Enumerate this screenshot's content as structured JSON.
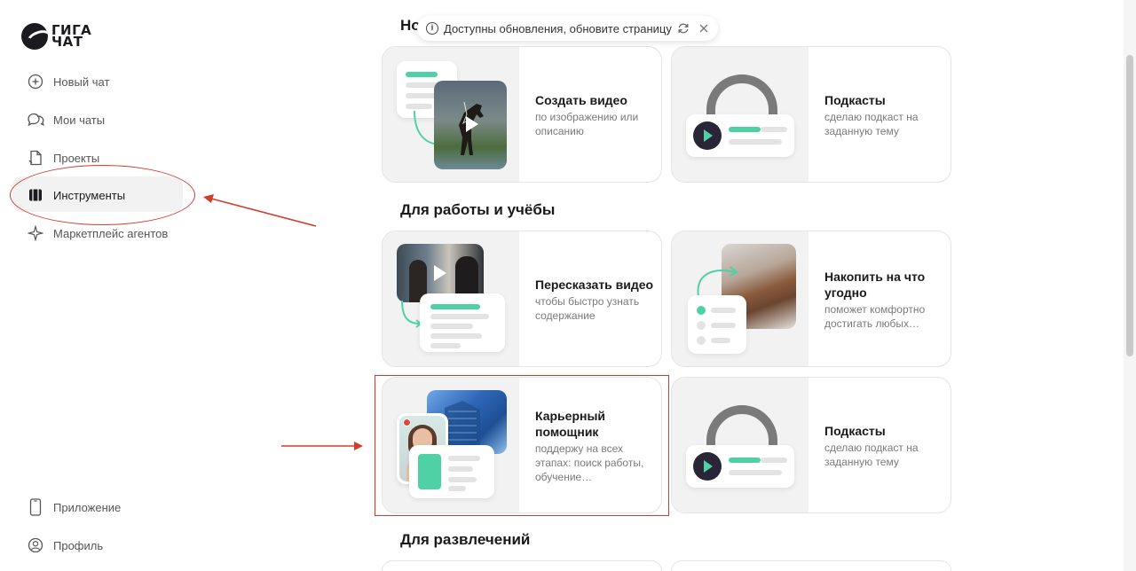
{
  "brand": {
    "logo_line1": "ГИГА",
    "logo_line2": "ЧАТ"
  },
  "sidebar": {
    "items": [
      {
        "label": "Новый чат",
        "icon": "plus-circle-icon"
      },
      {
        "label": "Мои чаты",
        "icon": "chat-bubbles-icon"
      },
      {
        "label": "Проекты",
        "icon": "project-file-icon"
      },
      {
        "label": "Инструменты",
        "icon": "tools-icon",
        "active": true
      },
      {
        "label": "Маркетплейс агентов",
        "icon": "sparkle-icon"
      }
    ],
    "bottom": [
      {
        "label": "Приложение",
        "icon": "phone-icon"
      },
      {
        "label": "Профиль",
        "icon": "profile-icon"
      }
    ]
  },
  "toast": {
    "text": "Доступны обновления, обновите страницу"
  },
  "sections": {
    "new": {
      "title": "Но"
    },
    "work": {
      "title": "Для работы и учёбы"
    },
    "fun": {
      "title": "Для развлечений"
    }
  },
  "cards": {
    "video": {
      "title": "Создать видео",
      "desc": "по изображению или описанию"
    },
    "podcast1": {
      "title": "Подкасты",
      "desc": "сделаю подкаст на заданную тему"
    },
    "retell": {
      "title": "Пересказать видео",
      "desc": "чтобы быстро узнать содержание"
    },
    "save": {
      "title": "Накопить на что угодно",
      "desc": "поможет комфортно достигать любых…"
    },
    "career": {
      "title": "Карьерный помощник",
      "desc": "поддержу на всех этапах: поиск работы, обучение…"
    },
    "podcast2": {
      "title": "Подкасты",
      "desc": "сделаю подкаст на заданную тему"
    }
  },
  "colors": {
    "accent_green": "#4fd1a5",
    "annotation_red": "#d33b2c"
  }
}
